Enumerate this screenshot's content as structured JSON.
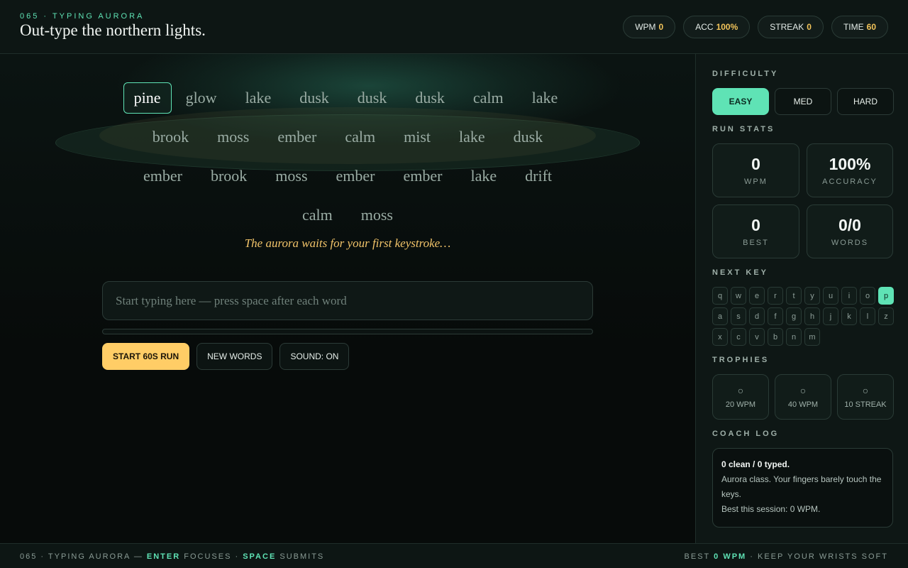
{
  "header": {
    "kicker": "065 · TYPING AURORA",
    "title": "Out-type the northern lights.",
    "pills": [
      {
        "label": "WPM",
        "value": "0"
      },
      {
        "label": "ACC",
        "value": "100%"
      },
      {
        "label": "STREAK",
        "value": "0"
      },
      {
        "label": "TIME",
        "value": "60"
      }
    ]
  },
  "words": {
    "lines": [
      [
        "pine",
        "glow",
        "lake",
        "dusk",
        "dusk",
        "dusk",
        "calm",
        "lake"
      ],
      [
        "brook",
        "moss",
        "ember",
        "calm",
        "mist",
        "lake",
        "dusk"
      ],
      [
        "ember",
        "brook",
        "moss",
        "ember",
        "ember",
        "lake",
        "drift"
      ],
      [
        "calm",
        "moss"
      ]
    ],
    "current": "pine"
  },
  "hint": "The aurora waits for your first keystroke…",
  "input": {
    "placeholder": "Start typing here — press space after each word",
    "value": ""
  },
  "progress": {
    "fraction": 0
  },
  "buttons": {
    "start": "START 60S RUN",
    "new_words": "NEW WORDS",
    "sound": "SOUND: ON"
  },
  "sidebar": {
    "difficulty_label": "DIFFICULTY",
    "difficulty": [
      {
        "label": "EASY",
        "active": true
      },
      {
        "label": "MED",
        "active": false
      },
      {
        "label": "HARD",
        "active": false
      }
    ],
    "run_stats_label": "RUN STATS",
    "stats": [
      {
        "value": "0",
        "label": "WPM"
      },
      {
        "value": "100%",
        "label": "ACCURACY"
      },
      {
        "value": "0",
        "label": "BEST"
      },
      {
        "value": "0/0",
        "label": "WORDS"
      }
    ],
    "next_key_label": "NEXT KEY",
    "keyboard": [
      [
        "q",
        "w",
        "e",
        "r",
        "t",
        "y",
        "u",
        "i",
        "o",
        "p"
      ],
      [
        "a",
        "s",
        "d",
        "f",
        "g",
        "h",
        "j",
        "k",
        "l",
        "z"
      ],
      [
        "x",
        "c",
        "v",
        "b",
        "n",
        "m"
      ]
    ],
    "next_key": "p",
    "trophies_label": "TROPHIES",
    "trophies": [
      {
        "icon": "○",
        "label": "20 WPM"
      },
      {
        "icon": "○",
        "label": "40 WPM"
      },
      {
        "icon": "○",
        "label": "10 STREAK"
      }
    ],
    "coach_label": "COACH LOG",
    "coach": {
      "summary": "0 clean / 0 typed.",
      "line1": "Aurora class. Your fingers barely touch the keys.",
      "line2": "Best this session: 0 WPM."
    }
  },
  "footer": {
    "left_a": "065 · TYPING AURORA — ",
    "left_b": "ENTER",
    "left_c": " FOCUSES · ",
    "left_d": "SPACE",
    "left_e": " SUBMITS",
    "right_a": "BEST ",
    "right_b": "0 WPM",
    "right_c": " · KEEP YOUR WRISTS SOFT"
  },
  "colors": {
    "accent": "#5fe3b5",
    "gold": "#ffcd66",
    "background": "#070b0a"
  }
}
